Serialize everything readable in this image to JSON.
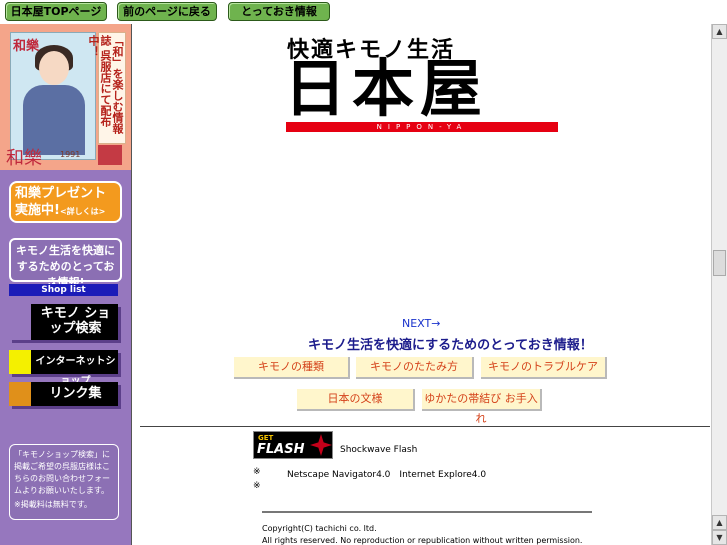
{
  "nav": {
    "top_label": "日本屋TOPページ",
    "back_label": "前のページに戻る",
    "info_label": "とっておき情報"
  },
  "sidebar": {
    "ad": {
      "magazine_title": "和樂",
      "side_text": "「和」を楽しむ情報誌 呉服店にて配布中！",
      "logo": "和樂",
      "year": "1991"
    },
    "present": {
      "line1": "和樂プレゼント",
      "line2": "実施中!",
      "more": "<詳しくは>"
    },
    "tips": {
      "text": "キモノ生活を快適にするためのとっておき情報!"
    },
    "shoplist": "Shop list",
    "menu": [
      {
        "label": "キモノ ショップ検索"
      },
      {
        "label": "インターネットショップ"
      },
      {
        "label": "リンク集"
      }
    ],
    "notice": {
      "body": "「キモノショップ検索」に掲載ご希望の呉服店様はこちらのお問い合わせフォームよりお願いいたします。",
      "free": "※掲載料は無料です。"
    }
  },
  "header": {
    "subtitle": "快適キモノ生活",
    "title": "日本屋",
    "romaji": "NIPPON-YA"
  },
  "content": {
    "next": "NEXT→",
    "tagline": "キモノ生活を快適にするためのとっておき情報！",
    "buttons": [
      "キモノの種類",
      "キモノのたたみ方",
      "キモノのトラブルケア",
      "日本の文様",
      "ゆかたの帯結び お手入れ"
    ]
  },
  "footer": {
    "flash_get": "GET",
    "flash_word": "FLASH",
    "flash_label": "Shockwave Flash",
    "req_mark": "※",
    "req_browsers": "Netscape Navigator4.0　Internet Explore4.0",
    "req_mark2": "※",
    "copyright": "Copyright(C) tachichi co. ltd.",
    "rights": "All rights reserved. No reproduction or republication without written permission."
  },
  "colors": {
    "sidebar_bg": "#9677be",
    "nav_button": "#6fb34e",
    "accent_red": "#e60012",
    "present_orange": "#f39a1e"
  }
}
